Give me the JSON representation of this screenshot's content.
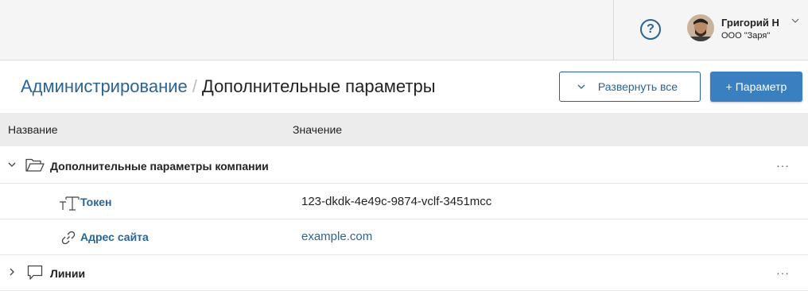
{
  "header": {
    "help_icon": "?",
    "user": {
      "name": "Григорий Н",
      "org": "ООО \"Заря\""
    }
  },
  "page": {
    "breadcrumb_root": "Администрирование",
    "breadcrumb_sep": "/",
    "title": "Дополнительные параметры",
    "expand_all_label": "Развернуть все",
    "add_param_label": "+ Параметр"
  },
  "table": {
    "columns": [
      "Название",
      "Значение"
    ],
    "rows": [
      {
        "type": "group",
        "label": "Дополнительные параметры компании",
        "expanded": true,
        "icon": "folder-open-icon",
        "more": "···"
      },
      {
        "type": "item",
        "label": "Токен",
        "icon": "text-type-icon",
        "value": "123-dkdk-4e49c-9874-vclf-3451mcc"
      },
      {
        "type": "item",
        "label": "Адрес сайта",
        "icon": "link-icon",
        "value": "example.com"
      },
      {
        "type": "group",
        "label": "Линии",
        "expanded": false,
        "icon": "chat-bubble-icon",
        "more": "···"
      }
    ]
  },
  "colors": {
    "accent": "#2a6496",
    "primary_button": "#3a7fc0",
    "topbar_bg": "#f5f5f5",
    "table_header_bg": "#ececec"
  }
}
